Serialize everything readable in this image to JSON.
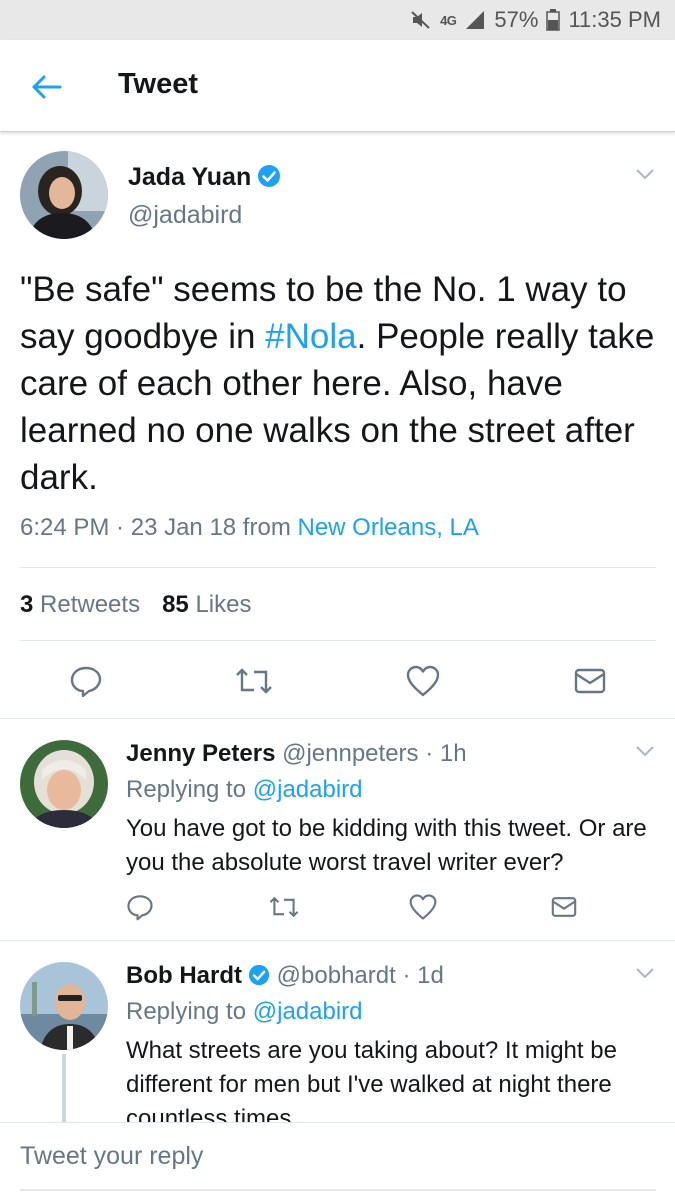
{
  "status_bar": {
    "network": "4G",
    "network_sub": "LTE",
    "battery": "57%",
    "time": "11:35 PM"
  },
  "header": {
    "title": "Tweet"
  },
  "main_tweet": {
    "author_name": "Jada Yuan",
    "author_handle": "@jadabird",
    "text_before": "\"Be safe\" seems to be the No. 1 way to say goodbye in ",
    "hashtag": "#Nola",
    "text_after": ". People really take care of each other here. Also, have learned no one walks on the street after dark.",
    "time": "6:24 PM",
    "date_sep": " · ",
    "date": "23 Jan 18",
    "from_label": " from ",
    "location": "New Orleans, LA",
    "retweets_count": "3",
    "retweets_label": "Retweets",
    "likes_count": "85",
    "likes_label": "Likes"
  },
  "replies": [
    {
      "author_name": "Jenny Peters",
      "author_handle": "@jennpeters",
      "time_sep": " · ",
      "time": "1h",
      "replying_label": "Replying to ",
      "replying_to": "@jadabird",
      "text": "You have got to be kidding with this tweet. Or are you the absolute worst travel writer ever?"
    },
    {
      "author_name": "Bob Hardt",
      "author_handle": "@bobhardt",
      "time_sep": " · ",
      "time": "1d",
      "replying_label": "Replying to ",
      "replying_to": "@jadabird",
      "text": "What streets are you taking about? It might be different for men but I've walked at night there countless times."
    }
  ],
  "composer": {
    "placeholder": "Tweet your reply"
  },
  "colors": {
    "brand_blue": "#1da1f2",
    "text_primary": "#14171a",
    "text_secondary": "#657786",
    "divider": "#e1e8ed"
  },
  "icons": {
    "back": "arrow-left-icon",
    "verified": "verified-badge-icon",
    "caret": "chevron-down-icon",
    "reply": "reply-bubble-icon",
    "retweet": "retweet-icon",
    "like": "heart-icon",
    "dm": "envelope-icon"
  }
}
